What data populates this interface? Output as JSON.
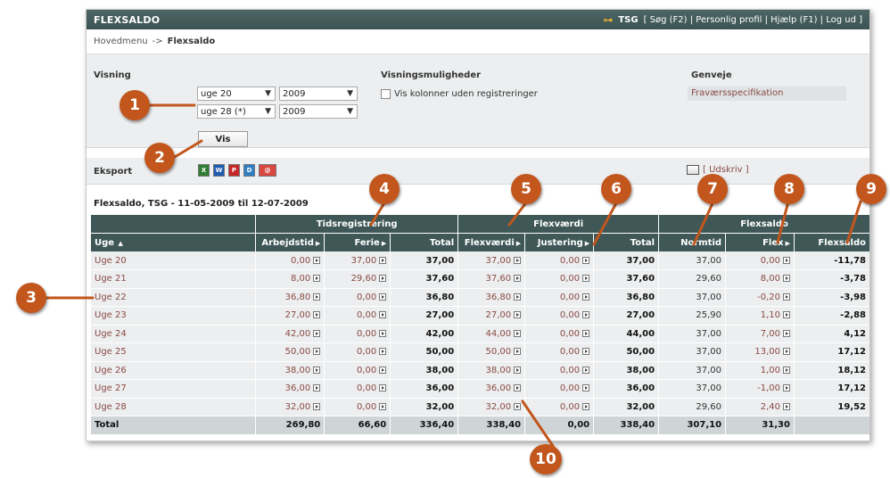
{
  "app": {
    "title": "FLEXSALDO",
    "user": "TSG",
    "links": "[ Søg (F2) | Personlig profil | Hjælp (F1) | Log ud ]"
  },
  "breadcrumb": {
    "home": "Hovedmenu",
    "sep": "->",
    "current": "Flexsaldo"
  },
  "options": {
    "visning_label": "Visning",
    "from_week": "uge 20",
    "from_year": "2009",
    "to_week": "uge 28 (*)",
    "to_year": "2009",
    "muligheder_label": "Visningsmuligheder",
    "checkbox_label": "Vis kolonner uden registreringer",
    "genveje_label": "Genveje",
    "shortcut": "Fraværsspecifikation",
    "vis_button": "Vis"
  },
  "export": {
    "label": "Eksport",
    "print_label": "[ Udskriv ]"
  },
  "report_title": "Flexsaldo, TSG - 11-05-2009 til 12-07-2009",
  "table": {
    "groups": [
      "Tidsregistrering",
      "Flexværdi",
      "Flexsaldo"
    ],
    "headers": [
      "Uge",
      "Arbejdstid",
      "Ferie",
      "Total",
      "Flexværdi",
      "Justering",
      "Total",
      "Normtid",
      "Flex",
      "Flexsaldo"
    ],
    "rows": [
      [
        "Uge 20",
        "0,00",
        "37,00",
        "37,00",
        "37,00",
        "0,00",
        "37,00",
        "37,00",
        "0,00",
        "-11,78"
      ],
      [
        "Uge 21",
        "8,00",
        "29,60",
        "37,60",
        "37,60",
        "0,00",
        "37,60",
        "29,60",
        "8,00",
        "-3,78"
      ],
      [
        "Uge 22",
        "36,80",
        "0,00",
        "36,80",
        "36,80",
        "0,00",
        "36,80",
        "37,00",
        "-0,20",
        "-3,98"
      ],
      [
        "Uge 23",
        "27,00",
        "0,00",
        "27,00",
        "27,00",
        "0,00",
        "27,00",
        "25,90",
        "1,10",
        "-2,88"
      ],
      [
        "Uge 24",
        "42,00",
        "0,00",
        "42,00",
        "44,00",
        "0,00",
        "44,00",
        "37,00",
        "7,00",
        "4,12"
      ],
      [
        "Uge 25",
        "50,00",
        "0,00",
        "50,00",
        "50,00",
        "0,00",
        "50,00",
        "37,00",
        "13,00",
        "17,12"
      ],
      [
        "Uge 26",
        "38,00",
        "0,00",
        "38,00",
        "38,00",
        "0,00",
        "38,00",
        "37,00",
        "1,00",
        "18,12"
      ],
      [
        "Uge 27",
        "36,00",
        "0,00",
        "36,00",
        "36,00",
        "0,00",
        "36,00",
        "37,00",
        "-1,00",
        "17,12"
      ],
      [
        "Uge 28",
        "32,00",
        "0,00",
        "32,00",
        "32,00",
        "0,00",
        "32,00",
        "29,60",
        "2,40",
        "19,52"
      ]
    ],
    "total": [
      "Total",
      "269,80",
      "66,60",
      "336,40",
      "338,40",
      "0,00",
      "338,40",
      "307,10",
      "31,30",
      ""
    ]
  },
  "callouts": [
    "1",
    "2",
    "3",
    "4",
    "5",
    "6",
    "7",
    "8",
    "9",
    "10"
  ],
  "colors": {
    "header_bg": "#3f5857",
    "link": "#8a4a45",
    "callout": "#c2561c"
  }
}
